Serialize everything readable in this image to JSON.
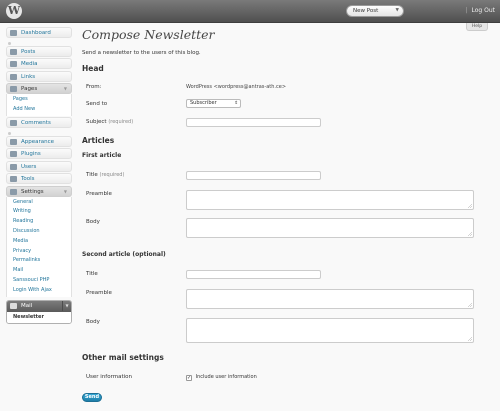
{
  "header": {
    "new_post": "New Post",
    "howdy_sep": "|",
    "logout": "Log Out",
    "help": "Help"
  },
  "sidebar": {
    "items": [
      {
        "label": "Dashboard"
      },
      {
        "label": "Posts"
      },
      {
        "label": "Media"
      },
      {
        "label": "Links"
      },
      {
        "label": "Pages"
      },
      {
        "label": "Comments"
      },
      {
        "label": "Appearance"
      },
      {
        "label": "Plugins"
      },
      {
        "label": "Users"
      },
      {
        "label": "Tools"
      },
      {
        "label": "Settings"
      },
      {
        "label": "Mail"
      }
    ],
    "pages_sub": [
      "Pages",
      "Add New"
    ],
    "settings_sub": [
      "General",
      "Writing",
      "Reading",
      "Discussion",
      "Media",
      "Privacy",
      "Permalinks",
      "Mail",
      "Sanssouci PHP",
      "Login With Ajax"
    ],
    "mail_sub": [
      "Newsletter"
    ]
  },
  "main": {
    "title": "Compose Newsletter",
    "description": "Send a newsletter to the users of this blog.",
    "head": {
      "heading": "Head",
      "from_label": "From:",
      "from_value": "WordPress <wordpress@antras-ath.ce>",
      "sendto_label": "Send to",
      "sendto_value": "Subscriber",
      "subject_label": "Subject",
      "subject_note": "(required)"
    },
    "articles": {
      "heading": "Articles",
      "first_heading": "First article",
      "second_heading": "Second article (optional)",
      "title_label": "Title",
      "title_note": "(required)",
      "preamble_label": "Preamble",
      "body_label": "Body"
    },
    "other": {
      "heading": "Other mail settings",
      "user_info_label": "User information",
      "include_label": "Include user information",
      "checked": "✓"
    },
    "send_label": "Send"
  }
}
